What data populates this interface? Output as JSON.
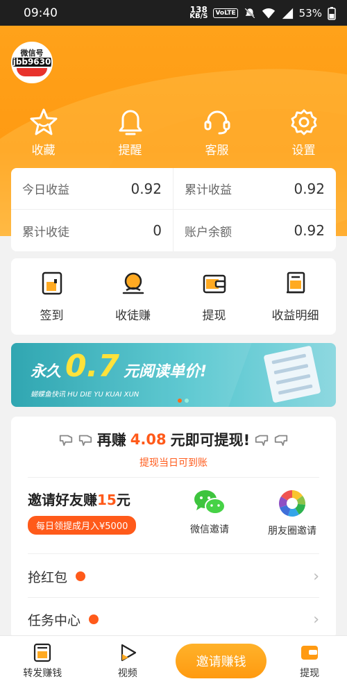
{
  "statusbar": {
    "time": "09:40",
    "net_speed": "138",
    "net_unit": "KB/S",
    "volte": "VoLTE",
    "battery": "53%"
  },
  "profile": {
    "avatar_line1": "微信号",
    "avatar_line2": "jbb9630"
  },
  "top_nav": [
    {
      "label": "收藏",
      "icon": "star-icon"
    },
    {
      "label": "提醒",
      "icon": "bell-icon"
    },
    {
      "label": "客服",
      "icon": "headset-icon"
    },
    {
      "label": "设置",
      "icon": "gear-icon"
    }
  ],
  "earnings": [
    {
      "label": "今日收益",
      "value": "0.92"
    },
    {
      "label": "累计收益",
      "value": "0.92"
    },
    {
      "label": "累计收徒",
      "value": "0"
    },
    {
      "label": "账户余额",
      "value": "0.92"
    }
  ],
  "quick_actions": [
    {
      "label": "签到",
      "icon": "signin-icon"
    },
    {
      "label": "收徒赚",
      "icon": "apprentice-icon"
    },
    {
      "label": "提现",
      "icon": "wallet-icon"
    },
    {
      "label": "收益明细",
      "icon": "ledger-icon"
    }
  ],
  "banner": {
    "prefix": "永久",
    "price": "0.7",
    "suffix": "元阅读单价!",
    "sub": "蝴蝶鱼快讯 HU DIE YU KUAI XUN"
  },
  "withdraw": {
    "before": "再赚",
    "amount": "4.08",
    "after": "元即可提现!",
    "note": "提现当日可到账"
  },
  "invite": {
    "title_before": "邀请好友赚",
    "amount": "15",
    "title_after": "元",
    "pill": "每日领提成月入¥5000"
  },
  "share": {
    "wechat": "微信邀请",
    "moments": "朋友圈邀请"
  },
  "rows": [
    {
      "label": "抢红包"
    },
    {
      "label": "任务中心"
    }
  ],
  "tabbar": {
    "repost": "转发赚钱",
    "video": "视频",
    "invite": "邀请赚钱",
    "withdraw": "提现"
  },
  "colors": {
    "orange": "#ff9a12",
    "accent": "#ff5a1a",
    "teal": "#1f9fab"
  }
}
